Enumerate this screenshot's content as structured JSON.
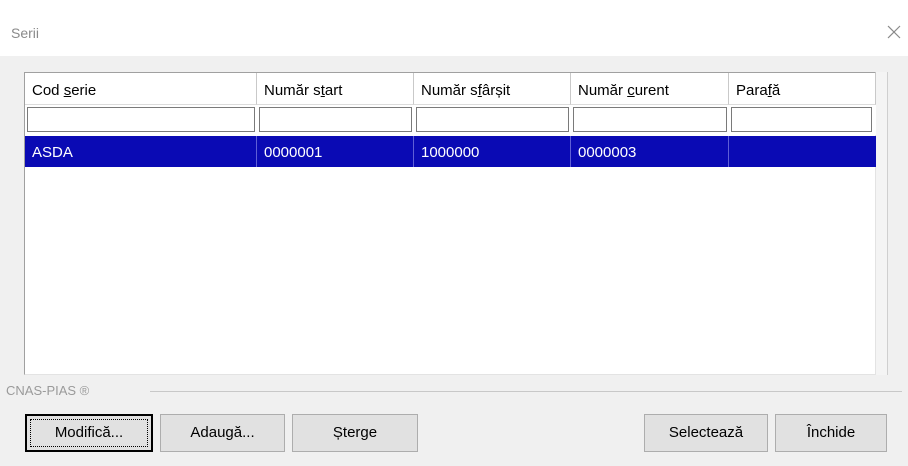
{
  "window": {
    "title": "Serii",
    "close_icon": "close-icon"
  },
  "grid": {
    "columns": [
      {
        "label": "Cod serie"
      },
      {
        "label": "Număr start"
      },
      {
        "label": "Număr sfârșit"
      },
      {
        "label": "Număr curent"
      },
      {
        "label": "Parafă"
      }
    ],
    "filters": [
      "",
      "",
      "",
      "",
      ""
    ],
    "rows": [
      {
        "cells": [
          "ASDA",
          "0000001",
          "1000000",
          "0000003",
          ""
        ],
        "selected": true
      }
    ],
    "selection_color": "#0a0ab4"
  },
  "group": {
    "label": "CNAS-PIAS ®"
  },
  "buttons": {
    "modify": "Modifică...",
    "add": "Adaugă...",
    "delete": "Șterge",
    "select": "Selectează",
    "close": "Închide"
  }
}
